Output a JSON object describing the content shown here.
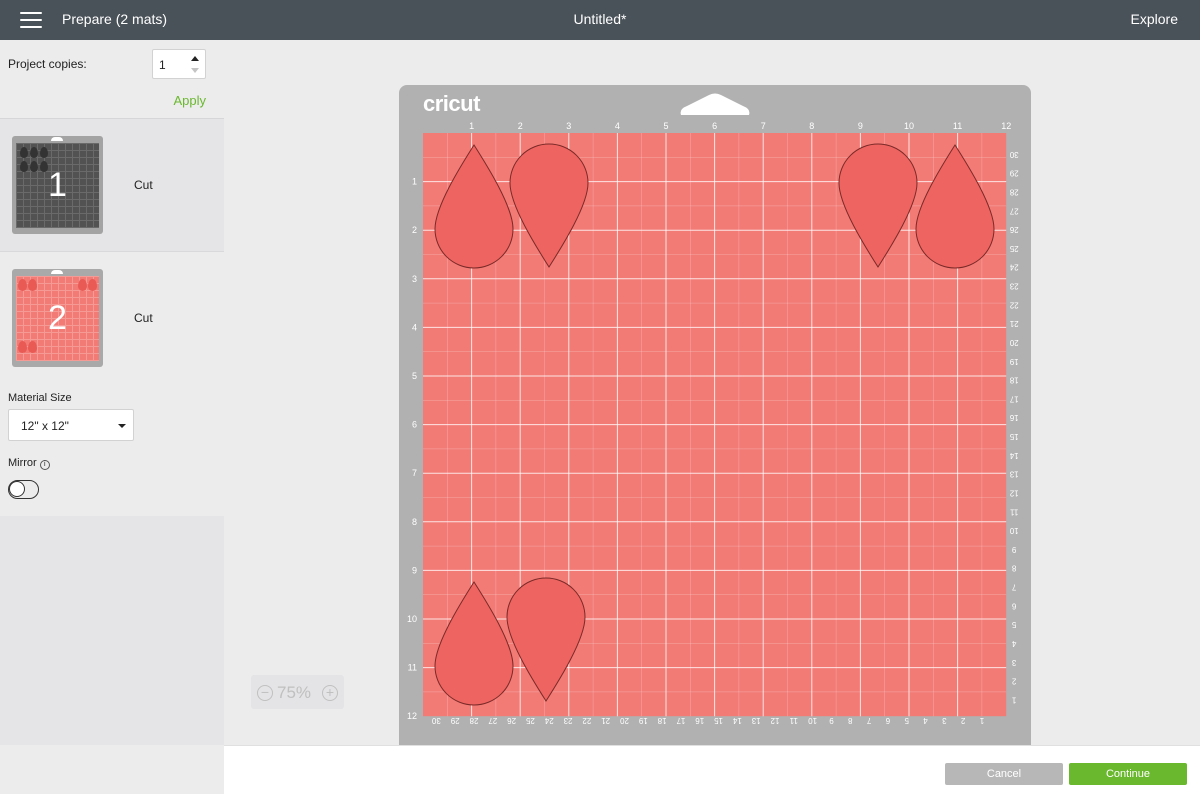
{
  "header": {
    "title": "Prepare (2 mats)",
    "document": "Untitled*",
    "explore": "Explore"
  },
  "sidebar": {
    "copies_label": "Project copies:",
    "copies_value": "1",
    "apply": "Apply",
    "mats": [
      {
        "number": "1",
        "action": "Cut",
        "color": "#4f4f4f"
      },
      {
        "number": "2",
        "action": "Cut",
        "color": "#f27b76"
      }
    ],
    "material_size_label": "Material Size",
    "material_size": "12\" x 12\"",
    "mirror_label": "Mirror",
    "mirror_on": false
  },
  "mat": {
    "logo": "cricut",
    "mat_color": "#f27b76",
    "shape_color": "#ee6460",
    "top_ruler": [
      "1",
      "2",
      "3",
      "4",
      "5",
      "6",
      "7",
      "8",
      "9",
      "10",
      "11",
      "12"
    ],
    "left_ruler": [
      "1",
      "2",
      "3",
      "4",
      "5",
      "6",
      "7",
      "8",
      "9",
      "10",
      "11",
      "12"
    ],
    "right_ruler": [
      "30",
      "29",
      "28",
      "27",
      "26",
      "25",
      "24",
      "23",
      "22",
      "21",
      "20",
      "19",
      "18",
      "17",
      "16",
      "15",
      "14",
      "13",
      "12",
      "11",
      "10",
      "9",
      "8",
      "7",
      "6",
      "5",
      "4",
      "3",
      "2",
      "1"
    ],
    "bottom_ruler": [
      "30",
      "29",
      "28",
      "27",
      "26",
      "25",
      "24",
      "23",
      "22",
      "21",
      "20",
      "19",
      "18",
      "17",
      "16",
      "15",
      "14",
      "13",
      "12",
      "11",
      "10",
      "9",
      "8",
      "7",
      "6",
      "5",
      "4",
      "3",
      "2",
      "1"
    ],
    "shapes": [
      "teardrop",
      "teardrop-inverted",
      "teardrop-inverted",
      "teardrop",
      "teardrop",
      "teardrop-inverted"
    ]
  },
  "zoom": {
    "value": "75%"
  },
  "footer": {
    "cancel": "Cancel",
    "continue": "Continue"
  }
}
